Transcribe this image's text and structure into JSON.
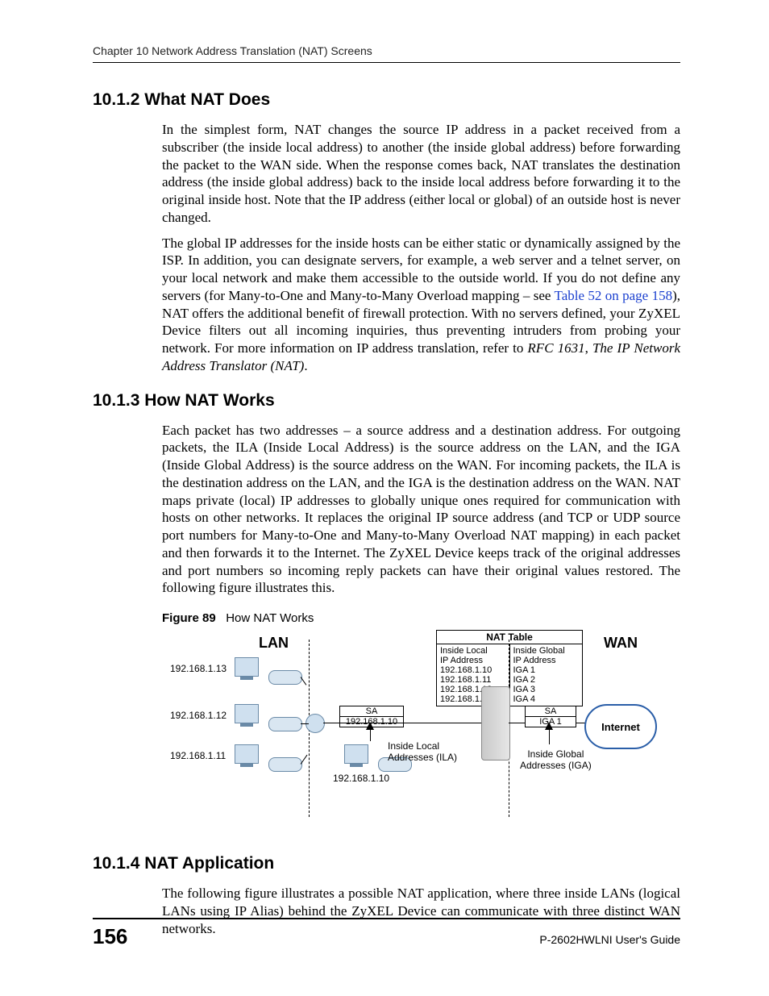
{
  "header": {
    "running_head": "Chapter 10 Network Address Translation (NAT) Screens"
  },
  "sections": {
    "s1": {
      "heading": "10.1.2  What NAT Does",
      "p1": "In the simplest form, NAT changes the source IP address in a packet received from a subscriber (the inside local address) to another (the inside global address) before forwarding the packet to the WAN side.  When the response comes back, NAT translates the destination address (the inside global address) back to the inside local address before forwarding it to the original inside host. Note that the IP address (either local or global) of an outside host is never changed.",
      "p2a": "The global IP addresses for the inside hosts can be either static or dynamically assigned by the ISP. In addition, you can designate servers, for example, a web server and a telnet server, on your local network and make them accessible to the outside world. If you do not define any servers (for Many-to-One and Many-to-Many Overload mapping – see ",
      "p2_link": "Table 52 on page 158",
      "p2b": "), NAT offers the additional benefit of firewall protection. With no servers defined, your ZyXEL Device filters out all incoming inquiries, thus preventing intruders from probing your network. For more information on IP address translation, refer to ",
      "p2_it1": "RFC 1631",
      "p2c": ", ",
      "p2_it2": "The IP Network Address Translator (NAT)",
      "p2d": "."
    },
    "s2": {
      "heading": "10.1.3  How NAT Works",
      "p1": "Each packet has two addresses – a source address and a destination address. For outgoing packets, the ILA (Inside Local Address) is the source address on the LAN, and the IGA (Inside Global Address) is the source address on the WAN. For incoming packets, the ILA is the destination address on the LAN, and the IGA is the destination address on the WAN. NAT maps private (local) IP addresses to globally unique ones required for communication with hosts on other networks. It replaces the original IP source address (and TCP or UDP source port numbers for Many-to-One and Many-to-Many Overload NAT mapping) in each packet and then forwards it to the Internet. The ZyXEL Device keeps track of the original addresses and port numbers so incoming reply packets can have their original values restored. The following figure illustrates this."
    },
    "fig": {
      "label": "Figure 89",
      "caption": "How NAT Works",
      "lan": "LAN",
      "wan": "WAN",
      "ip13": "192.168.1.13",
      "ip12": "192.168.1.12",
      "ip11": "192.168.1.11",
      "ip10": "192.168.1.10",
      "sa": "SA",
      "sa_val": "192.168.1.10",
      "sa2_val": "IGA 1",
      "ila_label": "Inside Local\nAddresses (ILA)",
      "iga_label": "Inside Global\nAddresses (IGA)",
      "nat_title": "NAT Table",
      "col1_h": "Inside Local\nIP Address",
      "col2_h": "Inside Global\nIP Address",
      "col1_r1": "192.168.1.10",
      "col2_r1": "IGA 1",
      "col1_r2": "192.168.1.11",
      "col2_r2": "IGA 2",
      "col1_r3": "192.168.1.12",
      "col2_r3": "IGA 3",
      "col1_r4": "192.168.1.13",
      "col2_r4": "IGA 4",
      "internet": "Internet"
    },
    "s3": {
      "heading": "10.1.4  NAT Application",
      "p1": "The following figure illustrates a possible NAT application, where three inside LANs (logical LANs using IP Alias) behind the ZyXEL Device can communicate with three distinct WAN networks."
    }
  },
  "footer": {
    "page": "156",
    "guide": "P-2602HWLNI User's Guide"
  }
}
